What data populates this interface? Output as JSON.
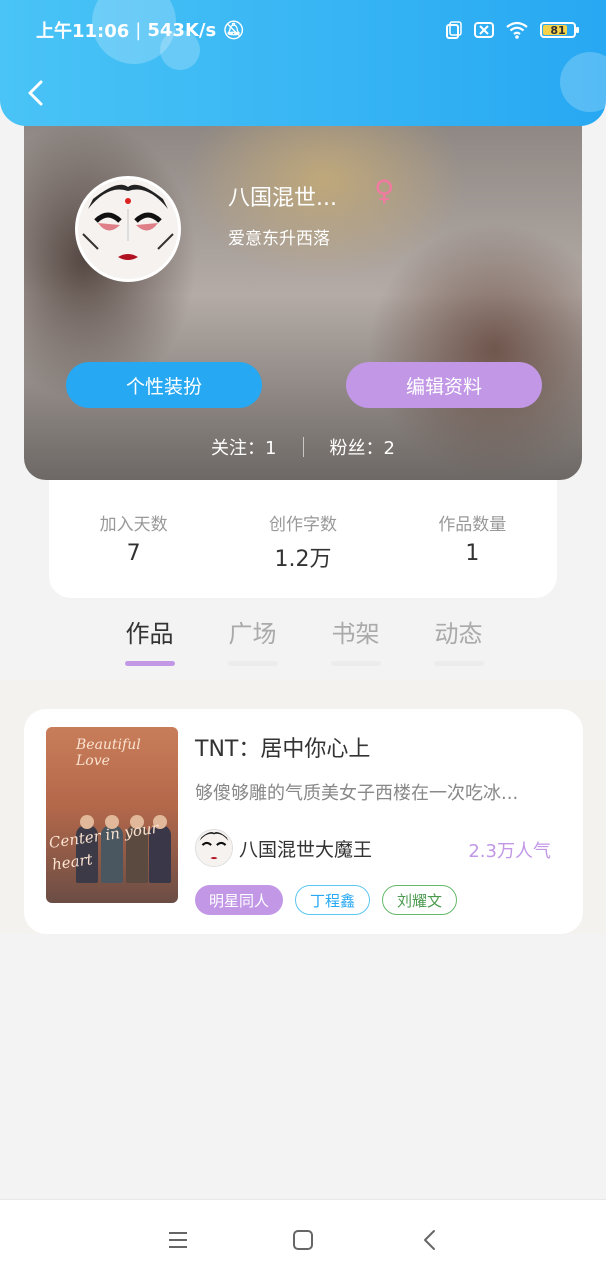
{
  "status_bar": {
    "time": "上午11:06",
    "speed": "543K/s",
    "battery": "81",
    "battery_fraction": 0.81
  },
  "profile": {
    "name": "八国混世...",
    "gender_symbol": "♀",
    "signature": "爱意东升西落",
    "dress_button": "个性装扮",
    "edit_button": "编辑资料",
    "following": "关注：1",
    "followers": "粉丝：2"
  },
  "stats": [
    {
      "label": "加入天数",
      "value": "7"
    },
    {
      "label": "创作字数",
      "value": "1.2万"
    },
    {
      "label": "作品数量",
      "value": "1"
    }
  ],
  "tabs": [
    {
      "label": "作品",
      "active": true
    },
    {
      "label": "广场",
      "active": false
    },
    {
      "label": "书架",
      "active": false
    },
    {
      "label": "动态",
      "active": false
    }
  ],
  "book": {
    "cover_title": "Beautiful Love",
    "cover_subtitle": "Center in your heart",
    "title": "TNT：居中你心上",
    "description": "够傻够雕的气质美女子西楼在一次吃冰...",
    "author": "八国混世大魔王",
    "popularity": "2.3万人气",
    "tags": [
      "明星同人",
      "丁程鑫",
      "刘耀文"
    ]
  },
  "colors": {
    "header_blue": "#27a8f2",
    "accent_purple": "#c197e6"
  },
  "icons": {
    "back": "chevron-left-icon",
    "menu": "menu-icon",
    "home": "home-square-icon",
    "nav_back": "nav-back-icon"
  }
}
